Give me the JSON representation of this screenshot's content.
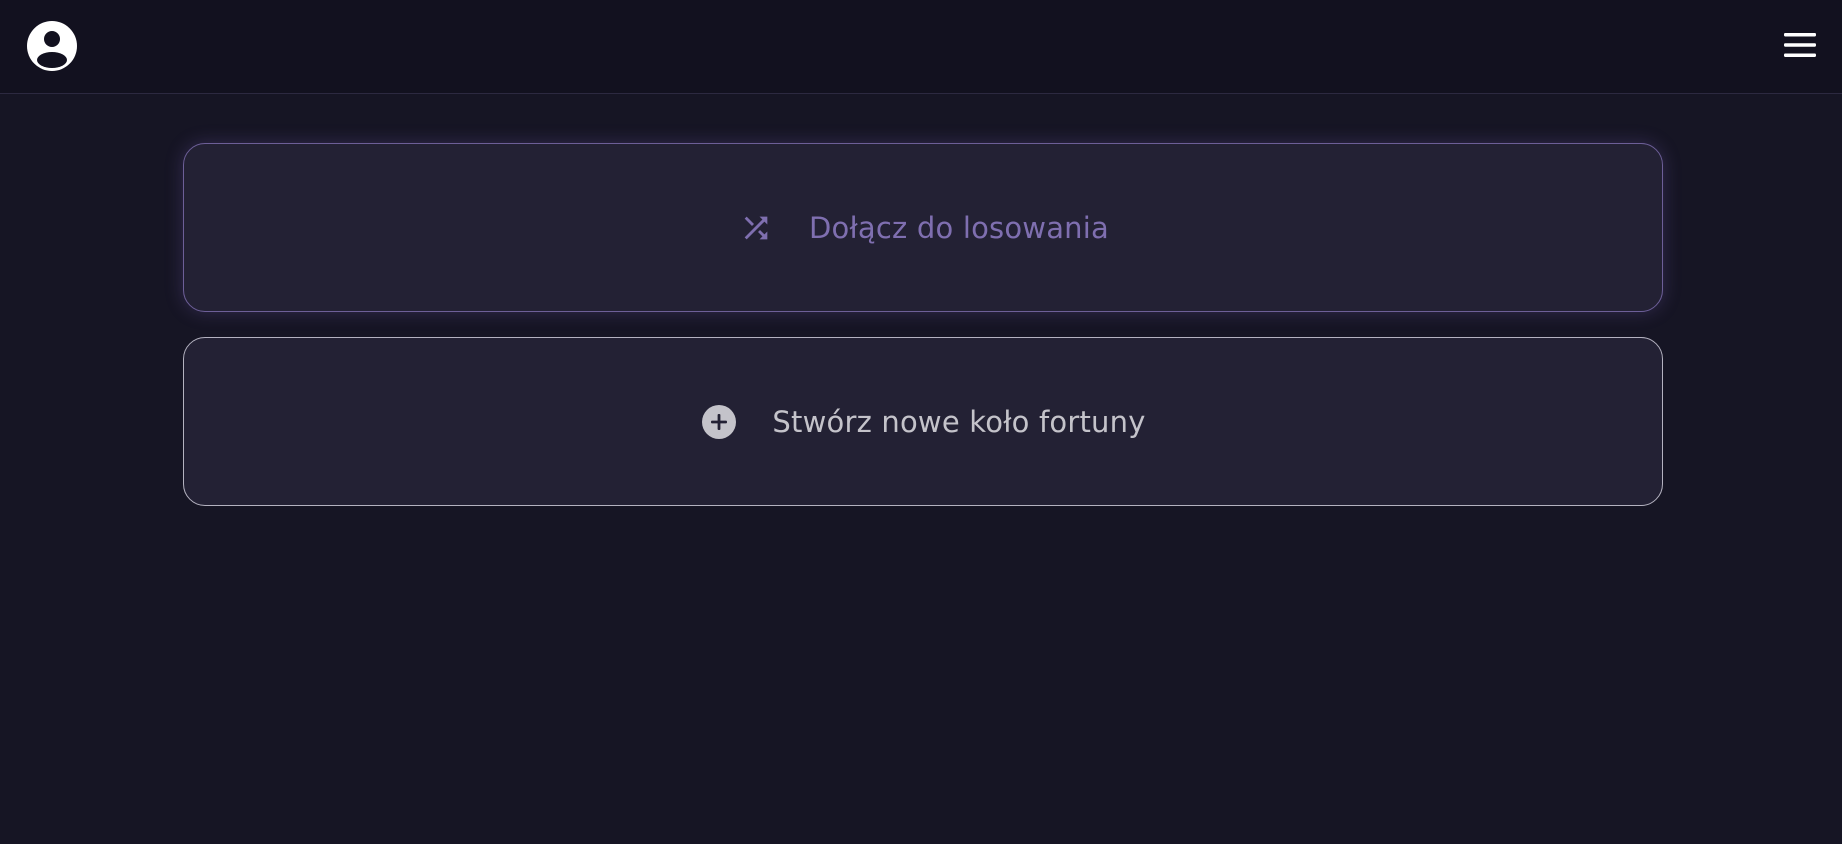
{
  "header": {
    "avatar_icon": "account-circle-icon",
    "menu_icon": "hamburger-menu-icon"
  },
  "actions": {
    "join": {
      "label": "Dołącz do losowania",
      "icon": "shuffle-icon",
      "color": "#7f6fb0"
    },
    "create": {
      "label": "Stwórz nowe koło fortuny",
      "icon": "plus-circle-icon",
      "color": "#c4c3ca"
    }
  },
  "colors": {
    "background": "#161524",
    "topbar": "#12111f",
    "card": "#232134",
    "accent": "#7f6fb0"
  }
}
